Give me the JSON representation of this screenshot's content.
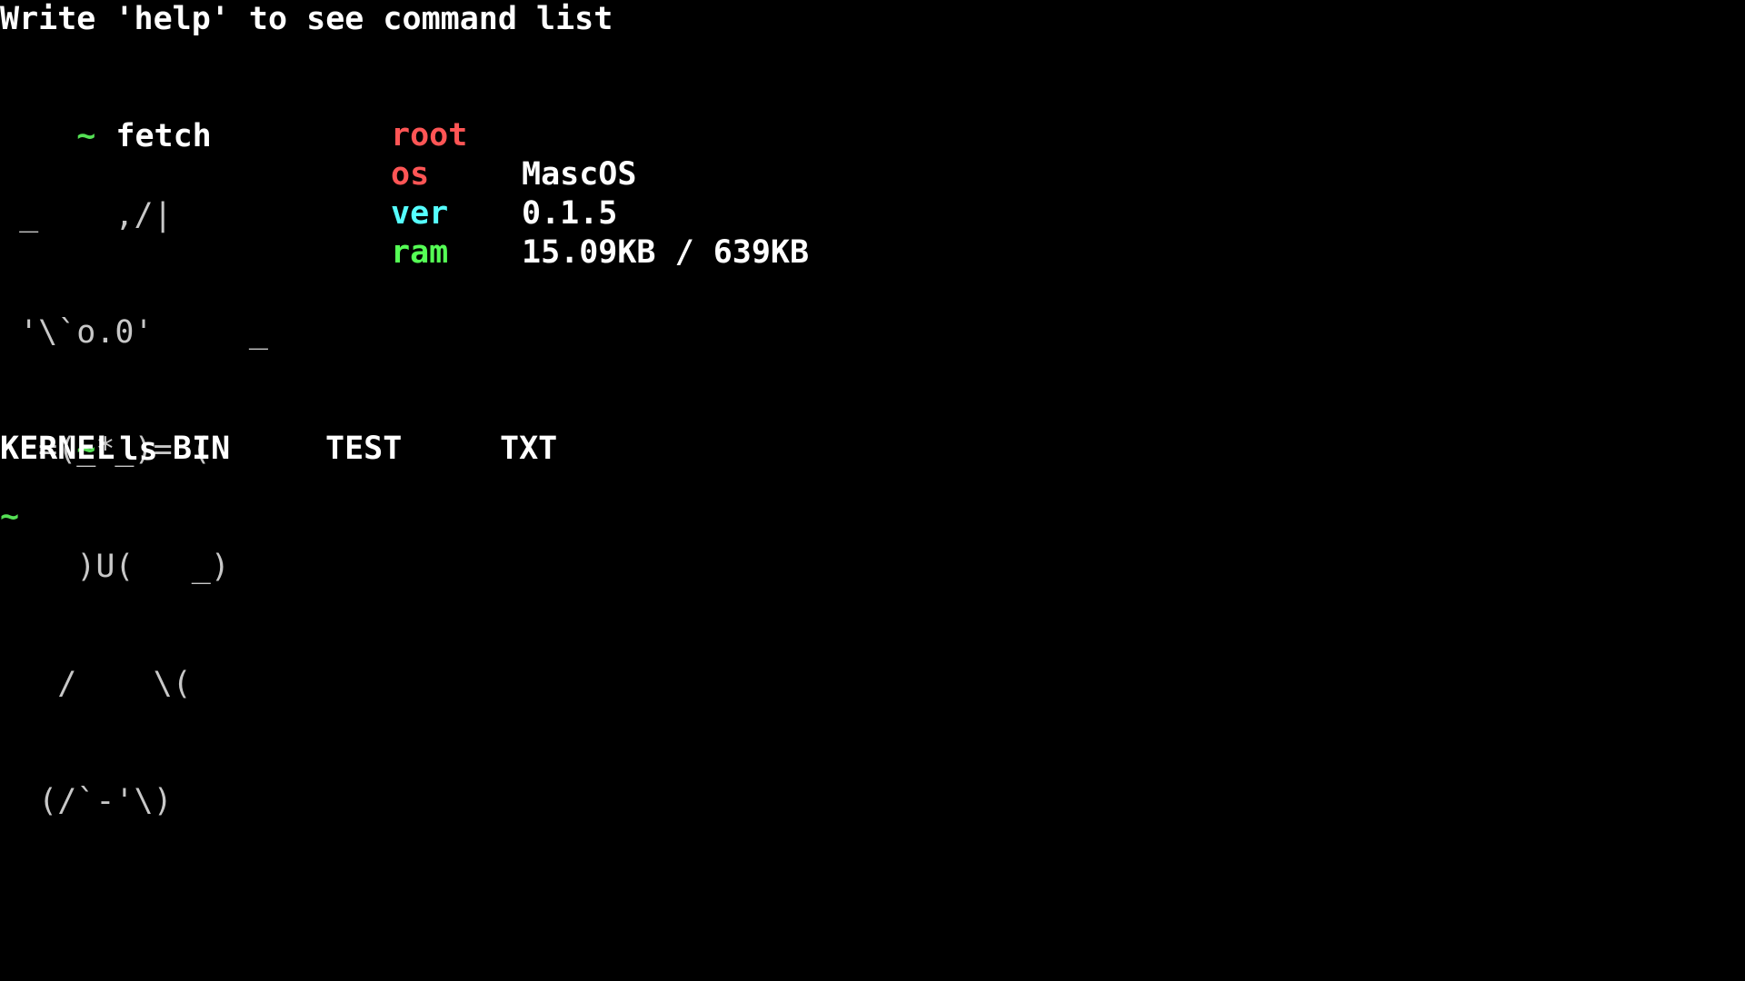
{
  "terminal": {
    "welcome": "Write 'help' to see command list",
    "prompt_symbol": "~",
    "colors": {
      "background": "#000000",
      "text": "#ffffff",
      "prompt": "#55e055",
      "user": "#ff5555",
      "os_key": "#ff5555",
      "ver_key": "#55ffff",
      "ram_key": "#55ff55",
      "ascii": "#c8c8c8"
    },
    "fetch": {
      "command": "fetch",
      "ascii_art": [
        " _    ,/|",
        " '\\`o.0'     _",
        "  =(_*_)= (",
        "    )U(   _)",
        "   /    \\(",
        "  (/`-'\\)"
      ],
      "user": "root",
      "rows": [
        {
          "key": "os",
          "value": "MascOS"
        },
        {
          "key": "ver",
          "value": "0.1.5"
        },
        {
          "key": "ram",
          "value": "15.09KB / 639KB"
        }
      ]
    },
    "ls": {
      "command": "ls",
      "items": [
        "KERNEL",
        "BIN",
        "TEST",
        "TXT"
      ]
    }
  }
}
